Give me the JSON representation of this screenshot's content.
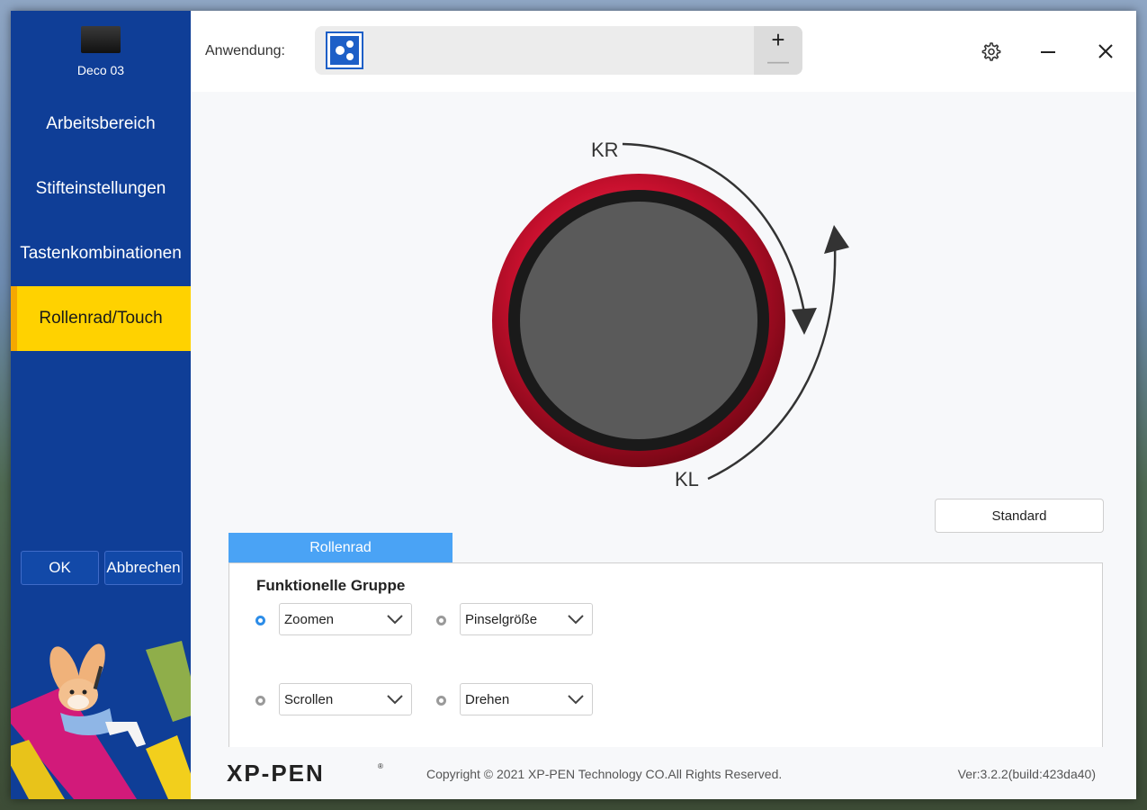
{
  "sidebar": {
    "device_name": "Deco 03",
    "items": [
      {
        "label": "Arbeitsbereich"
      },
      {
        "label": "Stifteinstellungen"
      },
      {
        "label": "Tastenkombinationen"
      },
      {
        "label": "Rollenrad/Touch"
      }
    ],
    "active_index": 3,
    "ok_label": "OK",
    "cancel_label": "Abbrechen"
  },
  "header": {
    "app_label": "Anwendung:",
    "add_symbol": "+",
    "remove_symbol": "—",
    "icons": [
      "gear-icon",
      "minimize-icon",
      "close-icon"
    ]
  },
  "wheel": {
    "clockwise_label": "KR",
    "counterclockwise_label": "KL",
    "ring_color": "#c8102e"
  },
  "main": {
    "standard_label": "Standard",
    "tab_label": "Rollenrad",
    "group_title": "Funktionelle Gruppe",
    "functions": [
      {
        "value": "Zoomen",
        "selected": true
      },
      {
        "value": "Pinselgröße",
        "selected": false
      },
      {
        "value": "Scrollen",
        "selected": false
      },
      {
        "value": "Drehen",
        "selected": false
      }
    ]
  },
  "footer": {
    "logo_text": "XP-PEN",
    "copyright": "Copyright © 2021 XP-PEN Technology CO.All Rights Reserved.",
    "version": "Ver:3.2.2(build:423da40)"
  },
  "colors": {
    "sidebar_bg": "#0f3e97",
    "active_bg": "#ffd200",
    "tab_bg": "#4aa3f5",
    "accent_blue": "#1d5fc7"
  }
}
